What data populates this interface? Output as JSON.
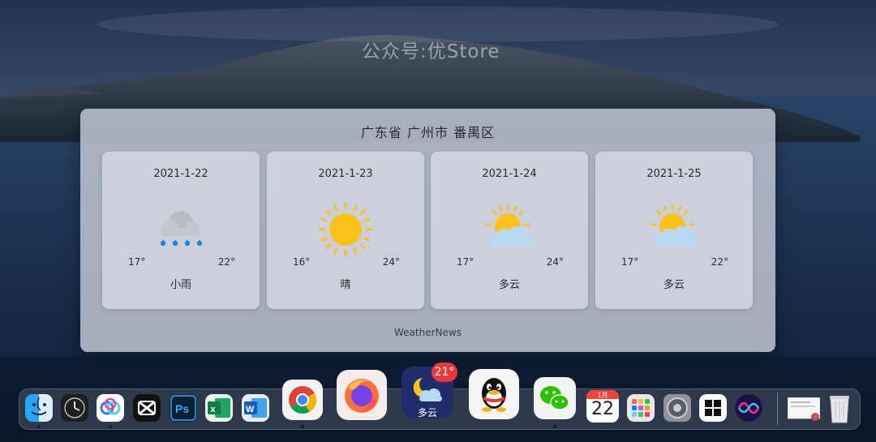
{
  "watermark": "公众号:优Store",
  "weather": {
    "location": "广东省 广州市 番禺区",
    "footer": "WeatherNews",
    "days": [
      {
        "date": "2021-1-22",
        "low": "17°",
        "high": "22°",
        "condition": "小雨",
        "icon": "cloud-rain-icon"
      },
      {
        "date": "2021-1-23",
        "low": "16°",
        "high": "24°",
        "condition": "晴",
        "icon": "sun-icon"
      },
      {
        "date": "2021-1-24",
        "low": "17°",
        "high": "24°",
        "condition": "多云",
        "icon": "partly-cloudy-icon"
      },
      {
        "date": "2021-1-25",
        "low": "17°",
        "high": "22°",
        "condition": "多云",
        "icon": "partly-cloudy-icon"
      }
    ]
  },
  "dock": {
    "weather_app": {
      "temp_badge": "21°",
      "label": "多云"
    },
    "calendar": {
      "month": "1月",
      "day": "22"
    },
    "icons": [
      "finder-icon",
      "clock-icon",
      "baidu-netdisk-icon",
      "capcut-icon",
      "photoshop-icon",
      "excel-icon",
      "word-icon",
      "chrome-icon",
      "firefox-icon",
      "weather-app-icon",
      "qq-icon",
      "wechat-icon",
      "calendar-icon",
      "launchpad-icon",
      "system-preferences-icon",
      "windows-icon",
      "siri-icon",
      "downloads-stack-icon",
      "trash-icon"
    ]
  },
  "colors": {
    "accent_sun": "#fcc21b",
    "cloud_blue": "#b8d9f2",
    "rain_blue": "#1f87de",
    "badge_red": "#e8383a"
  }
}
